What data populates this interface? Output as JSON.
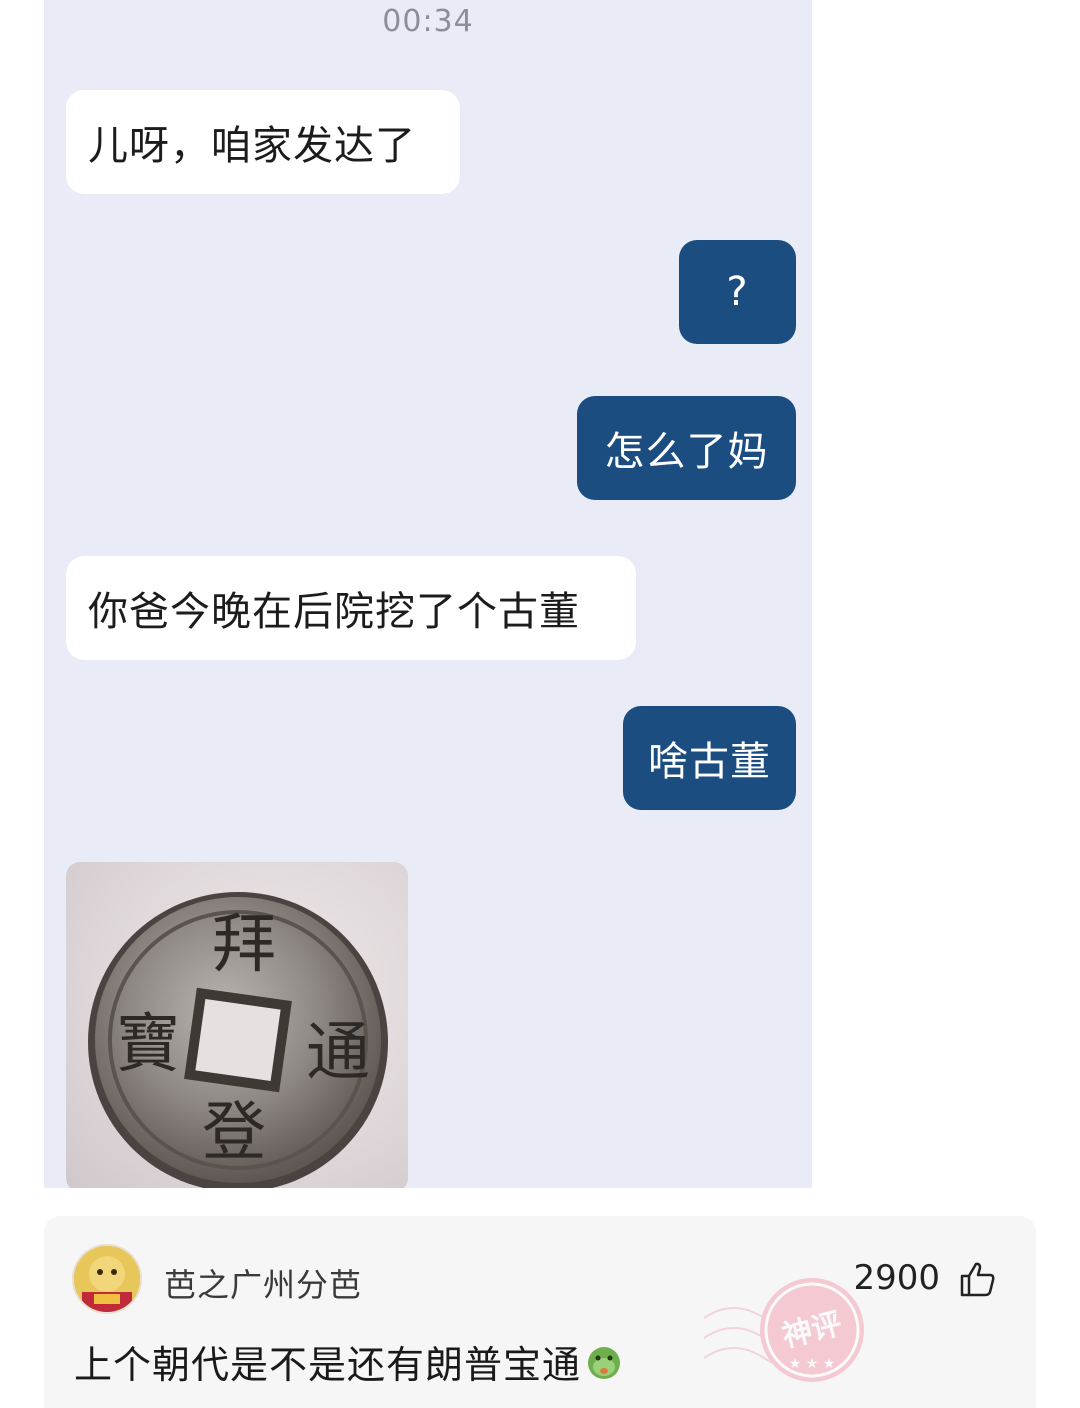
{
  "chat": {
    "timestamp": "00:34",
    "messages": [
      {
        "side": "incoming",
        "text": "儿呀，咱家发达了"
      },
      {
        "side": "outgoing",
        "text": "?"
      },
      {
        "side": "outgoing",
        "text": "怎么了妈"
      },
      {
        "side": "incoming",
        "text": "你爸今晚在后院挖了个古董"
      },
      {
        "side": "outgoing",
        "text": "啥古董"
      }
    ],
    "coin_image": {
      "inscription_top": "拜",
      "inscription_right": "通",
      "inscription_bottom": "登",
      "inscription_left": "寶"
    }
  },
  "comment": {
    "username": "芭之广州分芭",
    "likes": "2900",
    "text": "上个朝代是不是还有朗普宝通",
    "stamp_text": "神评",
    "icons": {
      "like": "thumbs-up-icon",
      "emoji": "green-face-emoji-icon",
      "stamp": "god-comment-stamp-icon"
    }
  },
  "colors": {
    "chat_background": "#e9ecf7",
    "incoming_bubble": "#ffffff",
    "outgoing_bubble": "#1b4d80",
    "timestamp": "#8c8f96"
  }
}
